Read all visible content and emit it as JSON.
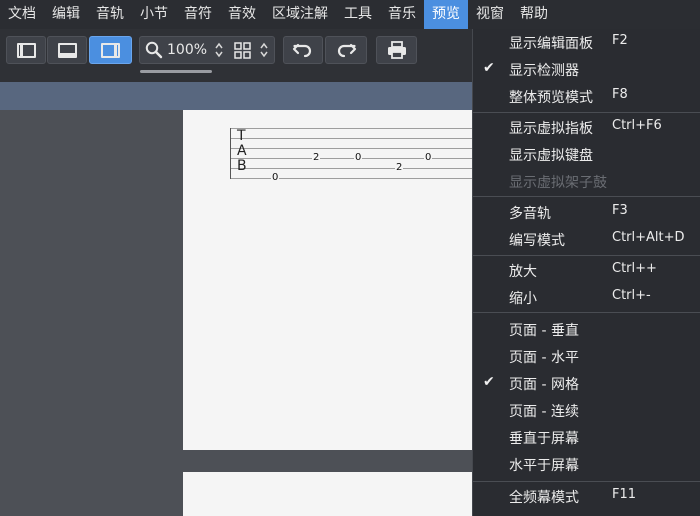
{
  "menubar": {
    "items": [
      {
        "label": "文档"
      },
      {
        "label": "编辑"
      },
      {
        "label": "音轨"
      },
      {
        "label": "小节"
      },
      {
        "label": "音符"
      },
      {
        "label": "音效"
      },
      {
        "label": "区域注解"
      },
      {
        "label": "工具"
      },
      {
        "label": "音乐"
      },
      {
        "label": "预览"
      },
      {
        "label": "视窗"
      },
      {
        "label": "帮助"
      }
    ],
    "active_index": 9
  },
  "toolbar": {
    "zoom_value": "100%",
    "zoom_slider_fraction": 1.0
  },
  "tab": {
    "letters": [
      "T",
      "A",
      "B"
    ],
    "frets": [
      "0",
      "2",
      "0",
      "2",
      "0"
    ]
  },
  "dropdown": {
    "items": [
      {
        "label": "显示编辑面板",
        "shortcut": "F2",
        "checked": false,
        "disabled": false
      },
      {
        "label": "显示检测器",
        "shortcut": "",
        "checked": true,
        "disabled": false
      },
      {
        "label": "整体预览模式",
        "shortcut": "F8",
        "checked": false,
        "disabled": false
      },
      {
        "label": "显示虚拟指板",
        "shortcut": "Ctrl+F6",
        "checked": false,
        "disabled": false
      },
      {
        "label": "显示虚拟键盘",
        "shortcut": "",
        "checked": false,
        "disabled": false
      },
      {
        "label": "显示虚拟架子鼓",
        "shortcut": "",
        "checked": false,
        "disabled": true
      },
      {
        "label": "多音轨",
        "shortcut": "F3",
        "checked": false,
        "disabled": false
      },
      {
        "label": "编写模式",
        "shortcut": "Ctrl+Alt+D",
        "checked": false,
        "disabled": false
      },
      {
        "label": "放大",
        "shortcut": "Ctrl++",
        "checked": false,
        "disabled": false
      },
      {
        "label": "缩小",
        "shortcut": "Ctrl+-",
        "checked": false,
        "disabled": false
      },
      {
        "label": "页面 - 垂直",
        "shortcut": "",
        "checked": false,
        "disabled": false
      },
      {
        "label": "页面 - 水平",
        "shortcut": "",
        "checked": false,
        "disabled": false
      },
      {
        "label": "页面 - 网格",
        "shortcut": "",
        "checked": true,
        "disabled": false
      },
      {
        "label": "页面 - 连续",
        "shortcut": "",
        "checked": false,
        "disabled": false
      },
      {
        "label": "垂直于屏幕",
        "shortcut": "",
        "checked": false,
        "disabled": false
      },
      {
        "label": "水平于屏幕",
        "shortcut": "",
        "checked": false,
        "disabled": false
      },
      {
        "label": "全频幕模式",
        "shortcut": "F11",
        "checked": false,
        "disabled": false
      }
    ],
    "check_glyph": "✔"
  }
}
